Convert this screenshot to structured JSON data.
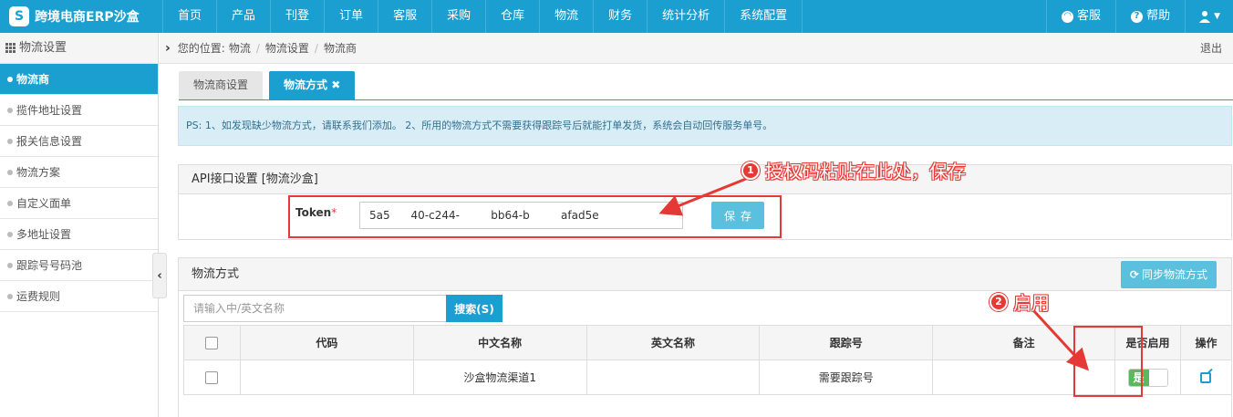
{
  "app": {
    "title": "跨境电商ERP沙盒",
    "logo_letter": "S"
  },
  "nav": {
    "items": [
      "首页",
      "产品",
      "刊登",
      "订单",
      "客服",
      "采购",
      "仓库",
      "物流",
      "财务",
      "统计分析",
      "系统配置"
    ],
    "right": {
      "service": "客服",
      "help": "帮助",
      "user_icon": "user-icon"
    }
  },
  "sidebar": {
    "title": "物流设置",
    "items": [
      "物流商",
      "揽件地址设置",
      "报关信息设置",
      "物流方案",
      "自定义面单",
      "多地址设置",
      "跟踪号号码池",
      "运费规则"
    ],
    "active_index": 0
  },
  "breadcrumb": {
    "prefix": "您的位置:",
    "path": [
      "物流",
      "物流设置",
      "物流商"
    ],
    "logout": "退出"
  },
  "tabs": [
    {
      "label": "物流商设置",
      "active": false
    },
    {
      "label": "物流方式 ✖",
      "active": true
    }
  ],
  "notice": "PS: 1、如发现缺少物流方式，请联系我们添加。 2、所用的物流方式不需要获得跟踪号后就能打单发货，系统会自动回传服务单号。",
  "api_panel": {
    "title": "API接口设置  [物流沙盒]",
    "token_label": "Token",
    "token_required": "*",
    "token_value": "5a5      40-c244-         bb64-b         afad5e",
    "save_label": "保存"
  },
  "shipping": {
    "title": "物流方式",
    "sync_label": "同步物流方式",
    "search_placeholder": "请输入中/英文名称",
    "search_button": "搜索(S)",
    "columns": [
      "代码",
      "中文名称",
      "英文名称",
      "跟踪号",
      "备注",
      "是否启用",
      "操作"
    ],
    "rows": [
      {
        "code": "",
        "name_cn": "沙盒物流渠道1",
        "name_en": "",
        "tracking": "需要跟踪号",
        "remark": "",
        "enabled_label": "是",
        "enabled": true
      }
    ]
  },
  "annotations": {
    "step1": {
      "num": "1",
      "text": "授权码粘贴在此处，保存"
    },
    "step2": {
      "num": "2",
      "text": "启用"
    }
  },
  "colors": {
    "primary": "#1a9fd0",
    "info": "#5bc0de",
    "success": "#5cb85c",
    "annotation": "#e53935"
  }
}
